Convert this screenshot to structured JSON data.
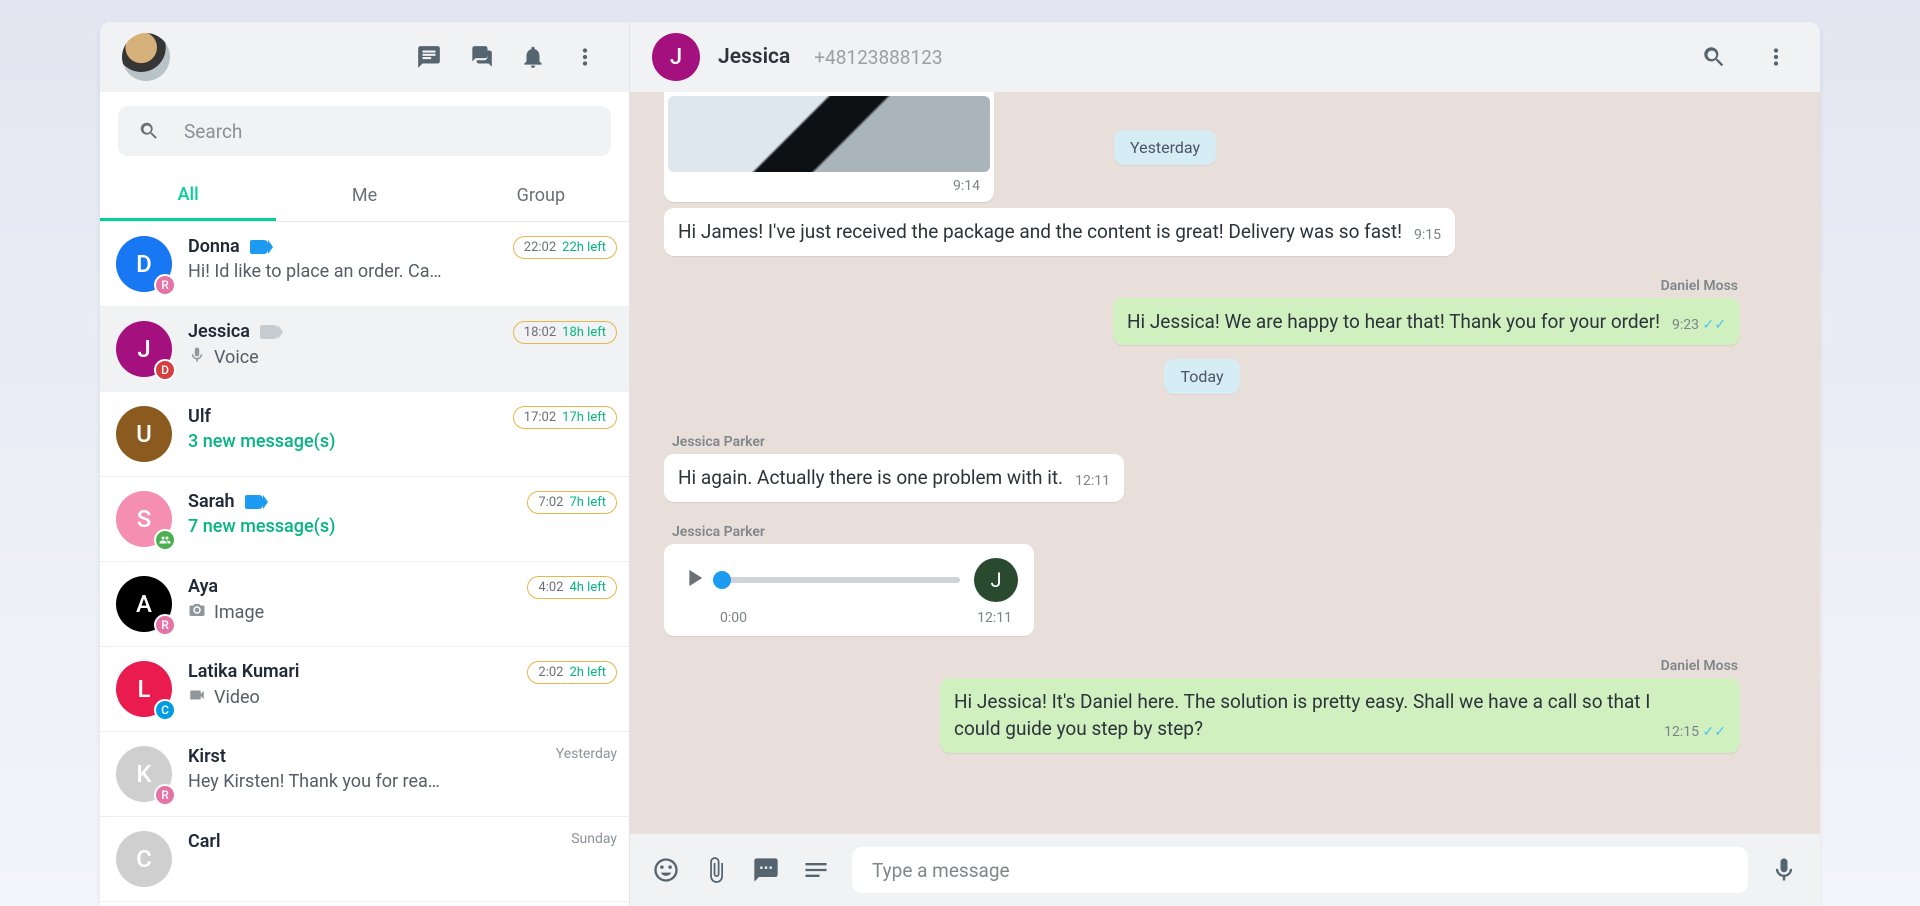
{
  "sidebar": {
    "search_placeholder": "Search",
    "tabs": [
      "All",
      "Me",
      "Group"
    ],
    "active_tab": 0,
    "chats": [
      {
        "initial": "D",
        "avatar_bg": "#1877f2",
        "badge": {
          "letter": "R",
          "bg": "#e573a6"
        },
        "name": "Donna",
        "tag": "blue",
        "preview": "Hi! Id like to place an order. Ca…",
        "pill_time": "22:02",
        "pill_left": "22h left",
        "active": false
      },
      {
        "initial": "J",
        "avatar_bg": "#a4117f",
        "badge": {
          "letter": "D",
          "bg": "#d53f3f"
        },
        "name": "Jessica",
        "tag": "grey",
        "icon": "mic",
        "preview": "Voice",
        "pill_time": "18:02",
        "pill_left": "18h left",
        "active": true
      },
      {
        "initial": "U",
        "avatar_bg": "#8a5a1e",
        "name": "Ulf",
        "preview": "3 new message(s)",
        "preview_green": true,
        "pill_time": "17:02",
        "pill_left": "17h left"
      },
      {
        "initial": "S",
        "avatar_bg": "#f48fb1",
        "badge": {
          "letter": "",
          "bg": "#4caf50",
          "icon": "group"
        },
        "name": "Sarah",
        "tag": "blue",
        "preview": "7 new message(s)",
        "preview_green": true,
        "pill_time": "7:02",
        "pill_left": "7h left"
      },
      {
        "initial": "A",
        "avatar_bg": "#000000",
        "badge": {
          "letter": "R",
          "bg": "#e573a6"
        },
        "name": "Aya",
        "icon": "camera",
        "preview": "Image",
        "pill_time": "4:02",
        "pill_left": "4h left"
      },
      {
        "initial": "L",
        "avatar_bg": "#e91b4f",
        "badge": {
          "letter": "C",
          "bg": "#039be5"
        },
        "name": "Latika Kumari",
        "icon": "video",
        "preview": "Video",
        "pill_time": "2:02",
        "pill_left": "2h left"
      },
      {
        "initial": "K",
        "avatar_bg": "#cfcfcf",
        "badge": {
          "letter": "R",
          "bg": "#e573a6"
        },
        "name": "Kirst",
        "preview": "Hey Kirsten! Thank you for rea…",
        "meta": "Yesterday"
      },
      {
        "initial": "C",
        "avatar_bg": "#cfcfcf",
        "name": "Carl",
        "preview": "",
        "meta": "Sunday"
      }
    ]
  },
  "header": {
    "initial": "J",
    "name": "Jessica",
    "phone": "+48123888123"
  },
  "thread": {
    "img_time": "9:14",
    "chip1": "Yesterday",
    "m1": {
      "text": "Hi James! I've just received the package and the content is great! Delivery was so fast!",
      "time": "9:15"
    },
    "s1": "Daniel Moss",
    "m2": {
      "text": "Hi Jessica! We are happy to hear that! Thank you for your order!",
      "time": "9:23"
    },
    "chip2": "Today",
    "s2": "Jessica Parker",
    "m3": {
      "text": "Hi again. Actually there is one problem with it.",
      "time": "12:11"
    },
    "s3": "Jessica Parker",
    "voice": {
      "elapsed": "0:00",
      "time": "12:11",
      "initial": "J"
    },
    "s4": "Daniel Moss",
    "m4": {
      "text": "Hi Jessica! It's Daniel here. The solution is pretty easy. Shall we have a call so that I could guide you step by step?",
      "time": "12:15"
    }
  },
  "composer": {
    "placeholder": "Type a message"
  }
}
